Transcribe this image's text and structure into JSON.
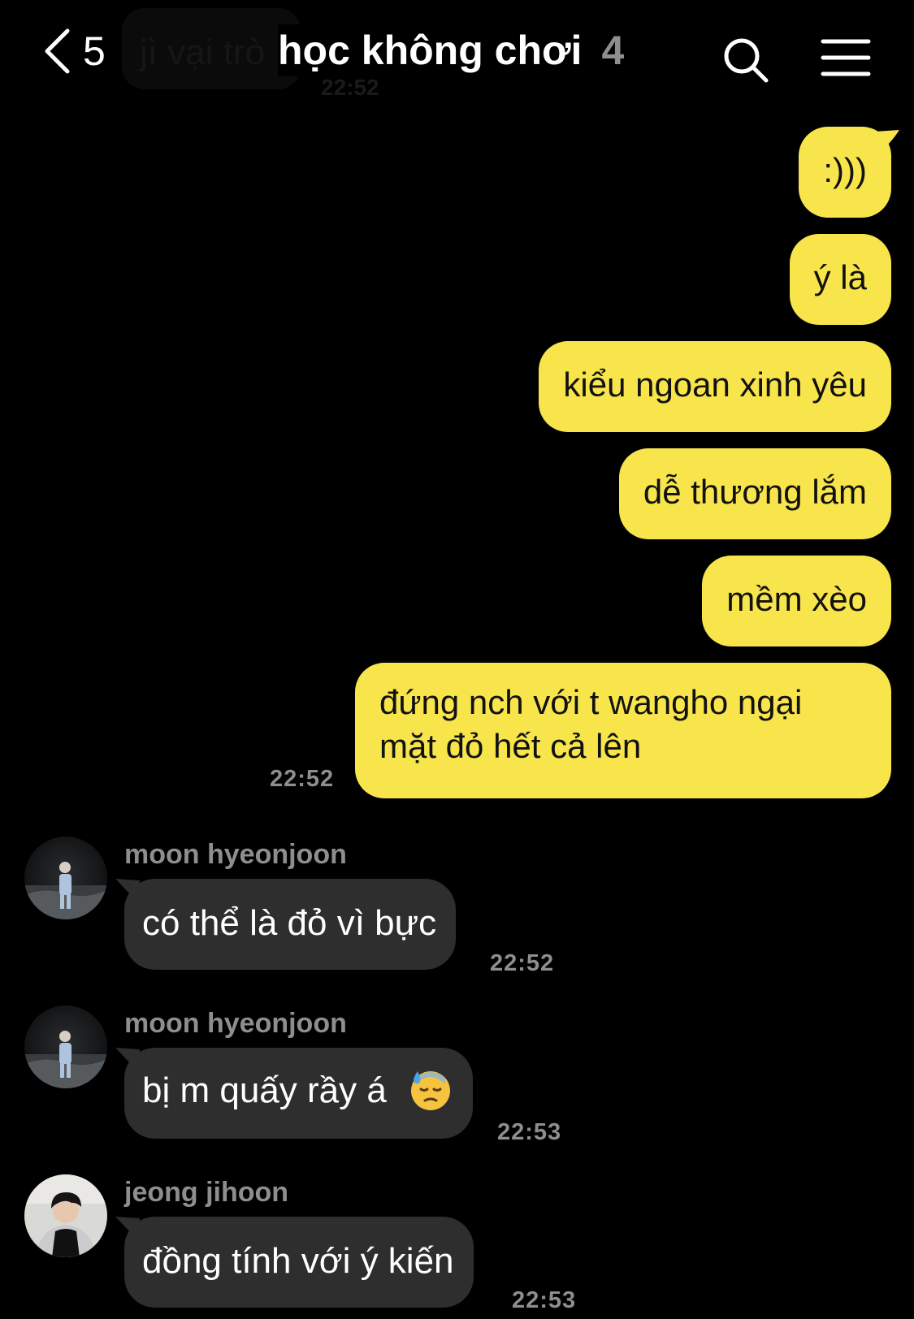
{
  "header": {
    "back_count": "5",
    "preview_text": "jì vại trò",
    "preview_time": "22:52",
    "title": "học không chơi",
    "member_count": "4"
  },
  "outgoing": [
    {
      "text": ":)))"
    },
    {
      "text": "ý là"
    },
    {
      "text": "kiểu ngoan xinh yêu"
    },
    {
      "text": "dễ thương lắm"
    },
    {
      "text": "mềm xèo"
    },
    {
      "line1": "đứng nch với t wangho ngại",
      "line2": "mặt đỏ hết cả lên",
      "time": "22:52"
    }
  ],
  "incoming": [
    {
      "sender": "moon hyeonjoon",
      "text": "có thể là đỏ vì bực",
      "time": "22:52"
    },
    {
      "sender": "moon hyeonjoon",
      "text": "bị m quấy rầy á",
      "emoji": "downcast-face-with-sweat",
      "time": "22:53"
    },
    {
      "sender": "jeong jihoon",
      "text": "đồng tính với ý kiến",
      "time": "22:53"
    }
  ],
  "icons": {
    "back": "chevron-left-icon",
    "search": "search-icon",
    "menu": "menu-icon"
  },
  "colors": {
    "background": "#000000",
    "outgoing_bubble": "#f8e54b",
    "incoming_bubble": "#2e2e2e",
    "muted_text": "#8e8e8e"
  }
}
